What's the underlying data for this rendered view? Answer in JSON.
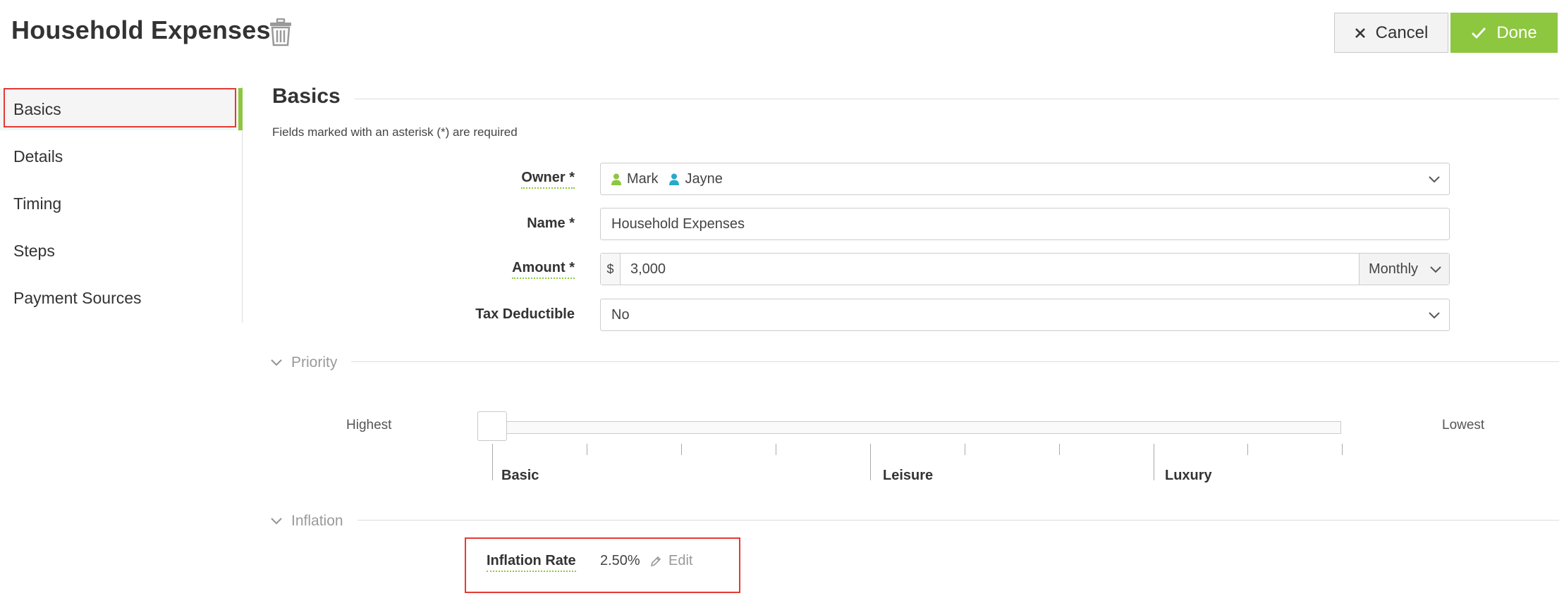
{
  "header": {
    "title": "Household Expenses",
    "delete_icon": "trash-icon",
    "cancel_label": "Cancel",
    "cancel_icon": "close-icon",
    "done_label": "Done",
    "done_icon": "check-icon"
  },
  "sidebar": {
    "items": [
      {
        "label": "Basics",
        "active": true
      },
      {
        "label": "Details",
        "active": false
      },
      {
        "label": "Timing",
        "active": false
      },
      {
        "label": "Steps",
        "active": false
      },
      {
        "label": "Payment Sources",
        "active": false
      }
    ]
  },
  "basics": {
    "title": "Basics",
    "required_note": "Fields marked with an asterisk (*) are required",
    "owner": {
      "label": "Owner *",
      "values": [
        {
          "name": "Mark",
          "icon": "person-icon",
          "color": "#8dc63f"
        },
        {
          "name": "Jayne",
          "icon": "person-icon",
          "color": "#29a9c9"
        }
      ]
    },
    "name": {
      "label": "Name *",
      "value": "Household Expenses"
    },
    "amount": {
      "label": "Amount *",
      "currency": "$",
      "value": "3,000",
      "frequency": "Monthly"
    },
    "tax_deductible": {
      "label": "Tax Deductible",
      "value": "No"
    }
  },
  "priority": {
    "title": "Priority",
    "low_end_label": "Highest",
    "high_end_label": "Lowest",
    "value": 0,
    "tick_labels": [
      "Basic",
      "Leisure",
      "Luxury"
    ]
  },
  "inflation": {
    "title": "Inflation",
    "rate_label": "Inflation Rate",
    "rate_value": "2.50%",
    "edit_label": "Edit"
  },
  "colors": {
    "accent": "#8dc63f",
    "highlight": "#e53935",
    "owner_secondary": "#29a9c9"
  }
}
